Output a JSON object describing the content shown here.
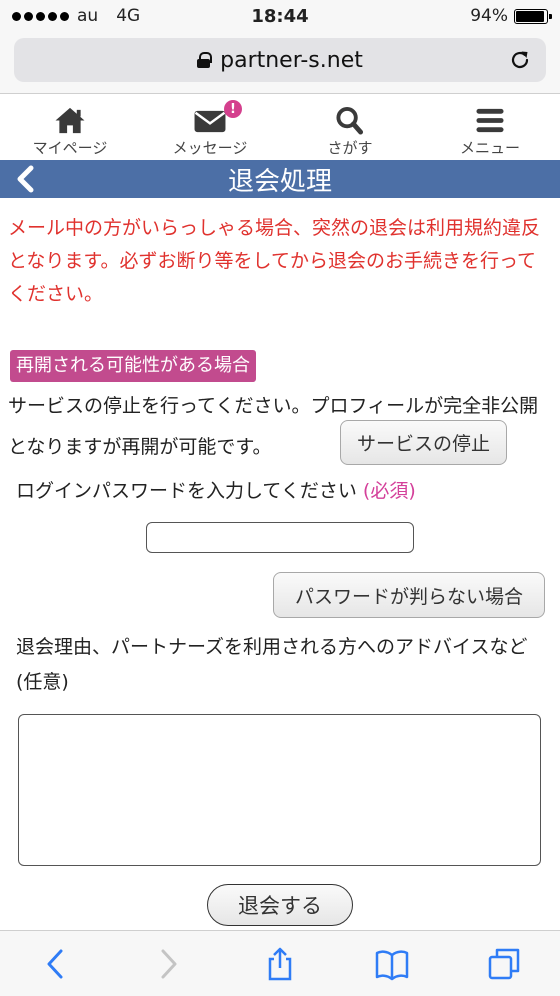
{
  "status_bar": {
    "carrier": "au",
    "network": "4G",
    "time": "18:44",
    "battery_text": "94%",
    "battery_level": 0.94
  },
  "browser": {
    "url": "partner-s.net"
  },
  "app_nav": {
    "items": [
      {
        "label": "マイページ",
        "icon": "home-icon"
      },
      {
        "label": "メッセージ",
        "icon": "mail-icon",
        "badge": "!"
      },
      {
        "label": "さがす",
        "icon": "search-icon"
      },
      {
        "label": "メニュー",
        "icon": "menu-icon"
      }
    ]
  },
  "page": {
    "title": "退会処理",
    "warning": "メール中の方がいらっしゃる場合、突然の退会は利用規約違反となります。必ずお断り等をしてから退会のお手続きを行ってください。",
    "section_tag": "再開される可能性がある場合",
    "pause_text": "サービスの停止を行ってください。プロフィールが完全非公開となりますが再開が可能です。",
    "pause_button": "サービスの停止",
    "password_label": "ログインパスワードを入力してください",
    "password_required": "(必須)",
    "password_value": "",
    "forgot_button": "パスワードが判らない場合",
    "reason_label": "退会理由、パートナーズを利用される方へのアドバイスなど (任意)",
    "reason_value": "",
    "withdraw_button": "退会する"
  },
  "colors": {
    "title_bar": "#4c6fa6",
    "warning_text": "#e0322e",
    "section_tag": "#c24b8e",
    "required": "#d4409a",
    "safari_blue": "#2f7cf6"
  }
}
